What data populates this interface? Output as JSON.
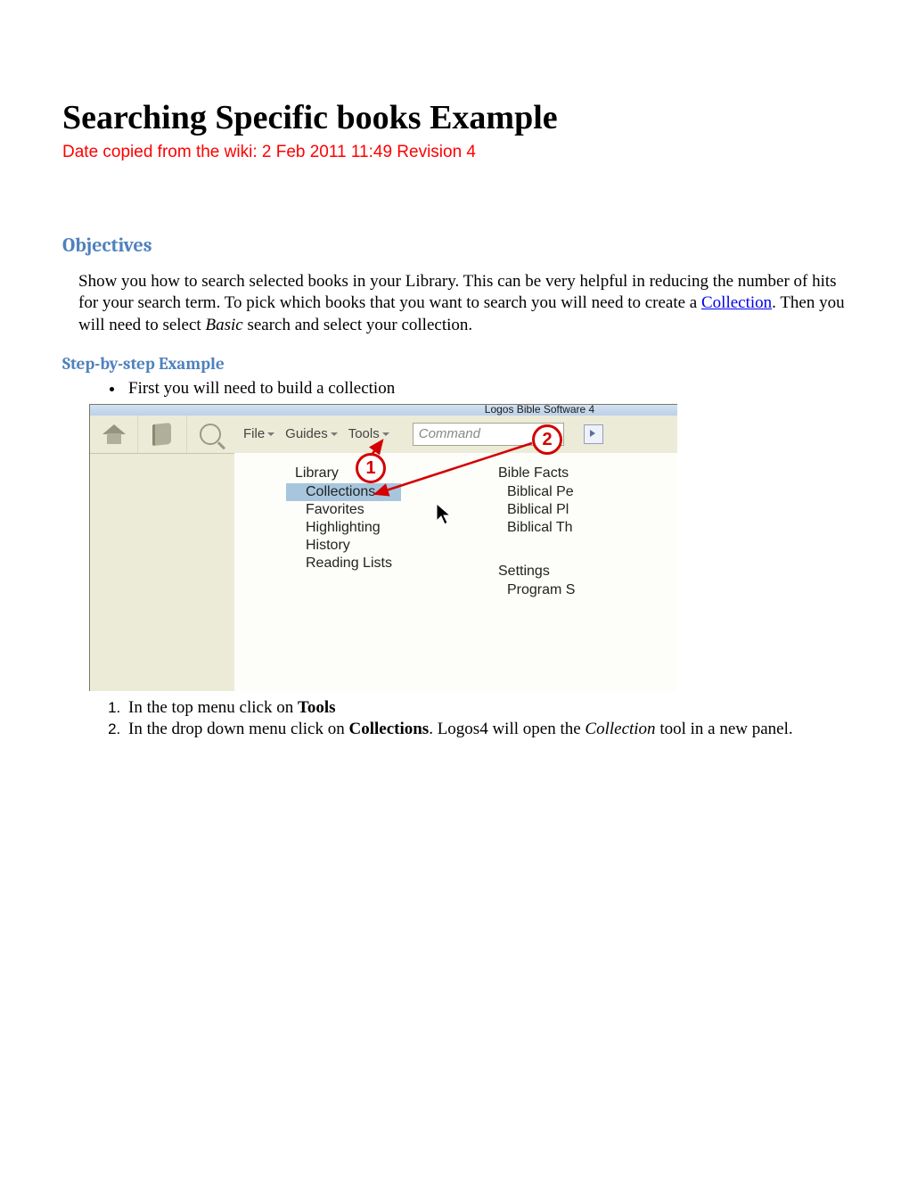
{
  "page": {
    "title": "Searching Specific books Example",
    "subtitle": "Date copied from the wiki: 2 Feb 2011   11:49   Revision  4"
  },
  "sections": {
    "objectives_heading": "Objectives",
    "objectives_pre": "Show you how to search selected books in your Library. This can be very helpful in reducing the number of hits for your search term. To pick which books that you want to search you will need to create a ",
    "objectives_link": "Collection",
    "objectives_post1": ". Then you will need to select ",
    "objectives_italic": "Basic",
    "objectives_post2": " search and select your collection.",
    "step_heading": "Step-by-step Example",
    "bullet1": "First you will need to build a collection",
    "num1_pre": "In the top menu click on ",
    "num1_bold": "Tools",
    "num2_pre": "In the drop down menu click on ",
    "num2_bold": "Collections",
    "num2_mid": ". Logos4 will open the ",
    "num2_italic": "Collection",
    "num2_post": " tool in a new panel."
  },
  "app": {
    "title": "Logos Bible Software 4",
    "menu_file": "File",
    "menu_guides": "Guides",
    "menu_tools": "Tools",
    "cmd_placeholder": "Command",
    "left_head": "Library",
    "left_items": [
      "Collections",
      "Favorites",
      "Highlighting",
      "History",
      "Reading Lists"
    ],
    "right_head": "Bible Facts",
    "right_items": [
      "Biblical Pe",
      "Biblical Pl",
      "Biblical Th"
    ],
    "right_head2": "Settings",
    "right_items2": [
      "Program S"
    ],
    "callout1": "1",
    "callout2": "2"
  }
}
